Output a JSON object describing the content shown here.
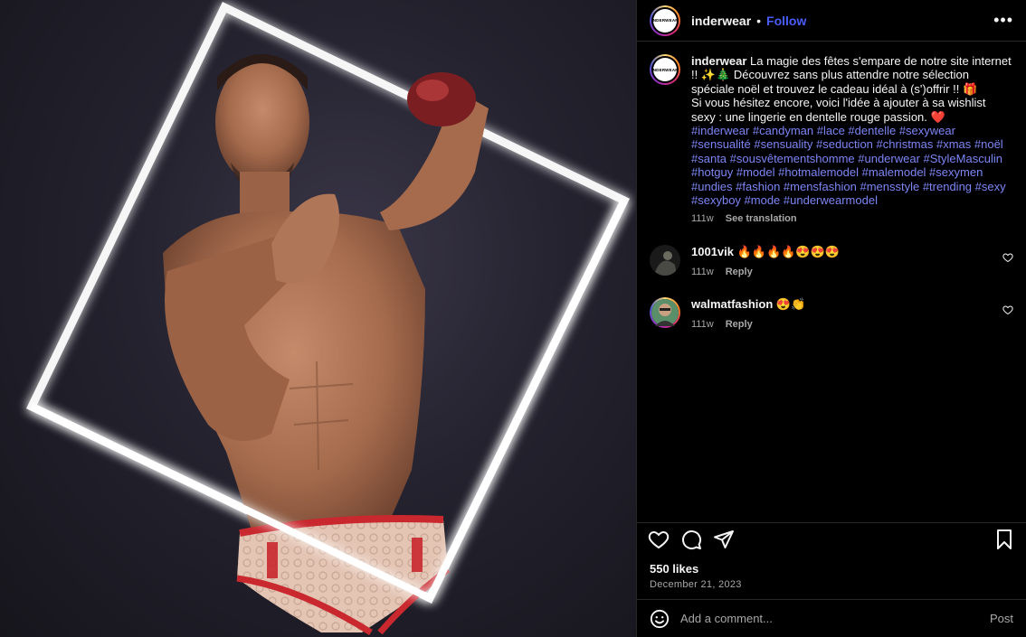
{
  "post": {
    "username": "inderwear",
    "follow_label": "Follow",
    "separator": "•",
    "more_label": "•••",
    "brand_avatar_text": "INDERWEAR"
  },
  "caption": {
    "username": "inderwear",
    "text": "La magie des fêtes s'empare de notre site internet !! ✨🎄 Découvrez sans plus attendre notre sélection spéciale noël et trouvez le cadeau idéal à (s')offrir !! 🎁",
    "text2": "Si vous hésitez encore, voici l'idée à ajouter à sa wishlist sexy : une lingerie en dentelle rouge passion. ❤️",
    "hashtags": "#inderwear #candyman #lace #dentelle #sexywear #sensualité #sensuality #seduction #christmas #xmas #noël #santa #sousvêtementshomme #underwear #StyleMasculin #hotguy #model #hotmalemodel #malemodel #sexymen #undies #fashion #mensfashion #mensstyle #trending #sexy #sexyboy #mode #underwearmodel",
    "time": "111w",
    "translate_label": "See translation"
  },
  "comments": [
    {
      "username": "1001vik",
      "text": "🔥🔥🔥🔥😍😍😍",
      "time": "111w",
      "reply_label": "Reply"
    },
    {
      "username": "walmatfashion",
      "text": "😍👏",
      "time": "111w",
      "reply_label": "Reply"
    }
  ],
  "stats": {
    "likes": "550 likes",
    "date": "December 21, 2023"
  },
  "composer": {
    "placeholder": "Add a comment...",
    "post_label": "Post"
  },
  "icons": [
    "more-icon",
    "heart-icon",
    "comment-icon",
    "share-icon",
    "bookmark-icon",
    "emoji-icon",
    "like-comment-icon"
  ],
  "colors": {
    "background": "#000000",
    "link_blue": "#4a5df9",
    "hashtag": "#7b86f7",
    "muted": "#a8a8a8",
    "underwear_red": "#c8282e"
  }
}
